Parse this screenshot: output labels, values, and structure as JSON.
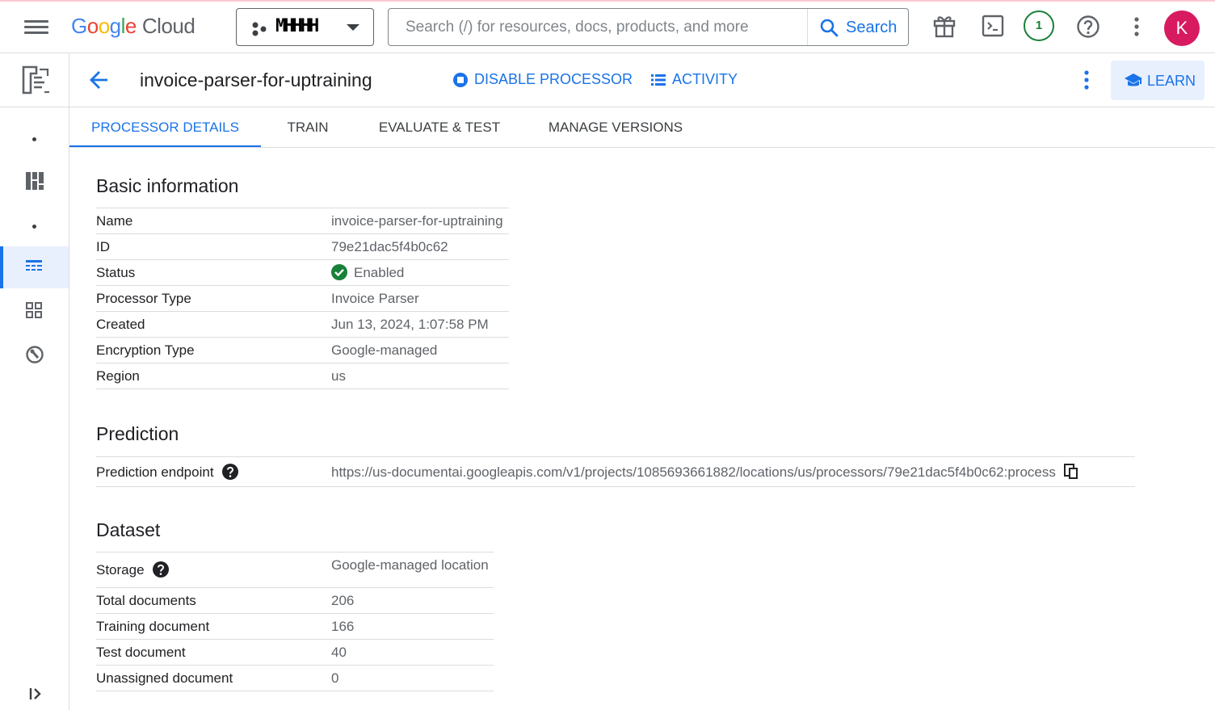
{
  "topbar": {
    "brand_google": "Google",
    "brand_cloud": "Cloud",
    "project_name": "MHHHH",
    "search_placeholder": "Search (/) for resources, docs, products, and more",
    "search_button": "Search",
    "notification_count": "1",
    "avatar_initial": "K"
  },
  "header": {
    "title": "invoice-parser-for-uptraining",
    "disable_button": "DISABLE PROCESSOR",
    "activity_button": "ACTIVITY",
    "learn_button": "LEARN"
  },
  "tabs": [
    {
      "label": "PROCESSOR DETAILS",
      "active": true
    },
    {
      "label": "TRAIN",
      "active": false
    },
    {
      "label": "EVALUATE & TEST",
      "active": false
    },
    {
      "label": "MANAGE VERSIONS",
      "active": false
    }
  ],
  "basic_info": {
    "title": "Basic information",
    "rows": [
      {
        "label": "Name",
        "value": "invoice-parser-for-uptraining"
      },
      {
        "label": "ID",
        "value": "79e21dac5f4b0c62"
      },
      {
        "label": "Status",
        "value": "Enabled"
      },
      {
        "label": "Processor Type",
        "value": "Invoice Parser"
      },
      {
        "label": "Created",
        "value": "Jun 13, 2024, 1:07:58 PM"
      },
      {
        "label": "Encryption Type",
        "value": "Google-managed"
      },
      {
        "label": "Region",
        "value": "us"
      }
    ]
  },
  "prediction": {
    "title": "Prediction",
    "endpoint_label": "Prediction endpoint",
    "endpoint_value": "https://us-documentai.googleapis.com/v1/projects/1085693661882/locations/us/processors/79e21dac5f4b0c62:process"
  },
  "dataset": {
    "title": "Dataset",
    "rows": [
      {
        "label": "Storage",
        "value": "Google-managed location"
      },
      {
        "label": "Total documents",
        "value": "206"
      },
      {
        "label": "Training document",
        "value": "166"
      },
      {
        "label": "Test document",
        "value": "40"
      },
      {
        "label": "Unassigned document",
        "value": "0"
      }
    ]
  },
  "colors": {
    "accent": "#1a73e8",
    "status_ok": "#188038",
    "avatar": "#d81b60"
  }
}
